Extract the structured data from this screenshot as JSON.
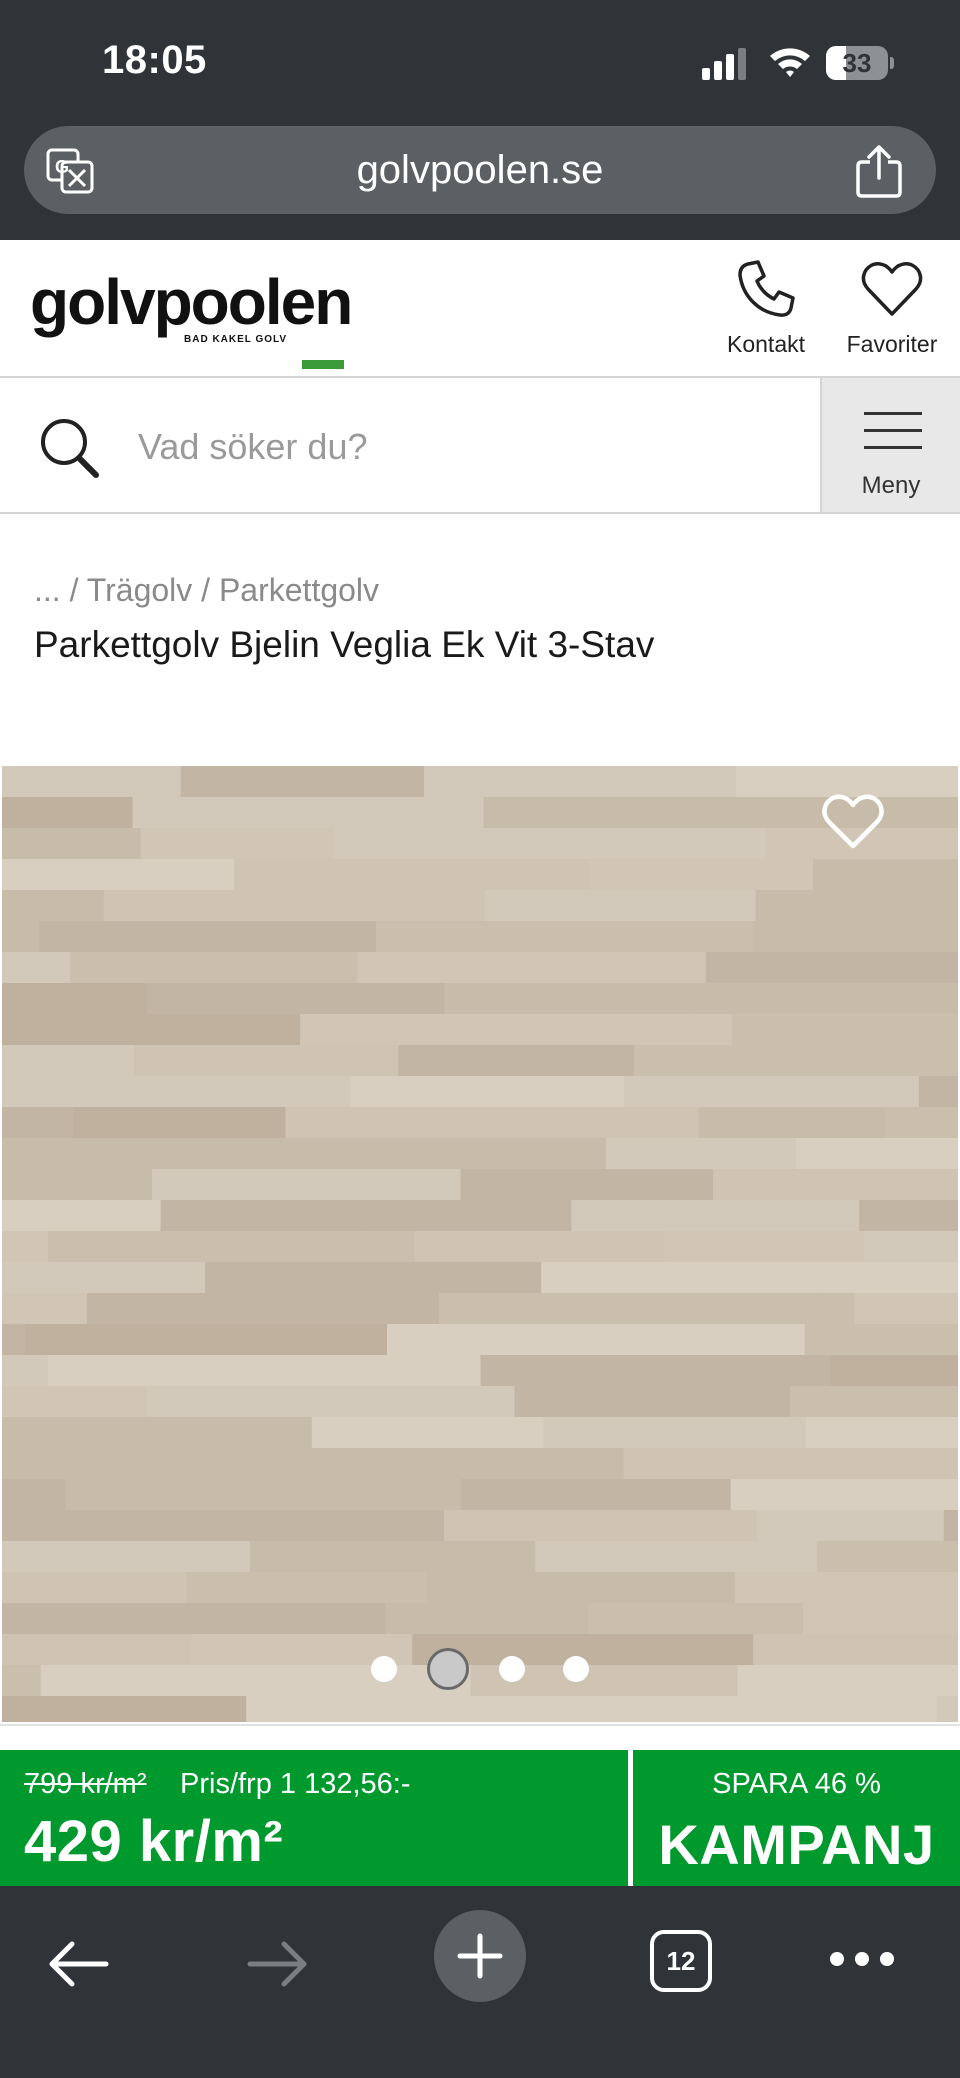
{
  "status_bar": {
    "time": "18:05",
    "battery_level": "33",
    "icons": [
      "cellular-signal-icon",
      "wifi-icon",
      "battery-icon"
    ]
  },
  "browser": {
    "url": "golvpoolen.se",
    "icons": [
      "translate-icon",
      "share-icon"
    ],
    "open_tabs": "12",
    "toolbar_icons": [
      "back-arrow-icon",
      "forward-arrow-icon",
      "plus-icon",
      "tabs-icon",
      "more-icon"
    ]
  },
  "site": {
    "logo_text": "golvpoolen",
    "logo_tagline": "BAD KAKEL GOLV",
    "contact_label": "Kontakt",
    "favorites_label": "Favoriter",
    "search_placeholder": "Vad söker du?",
    "menu_label": "Meny",
    "brand_green": "#00992d"
  },
  "breadcrumb": "... / Trägolv / Parkettgolv",
  "product": {
    "title": "Parkettgolv Bjelin Veglia Ek Vit 3-Stav",
    "gallery": {
      "image_count": 4,
      "active_index": 1
    },
    "old_price": "799 kr/m²",
    "package_price": "Pris/frp 1 132,56:-",
    "price": "429 kr/m²",
    "save_label": "SPARA 46 %",
    "campaign_label": "KAMPANJ"
  }
}
